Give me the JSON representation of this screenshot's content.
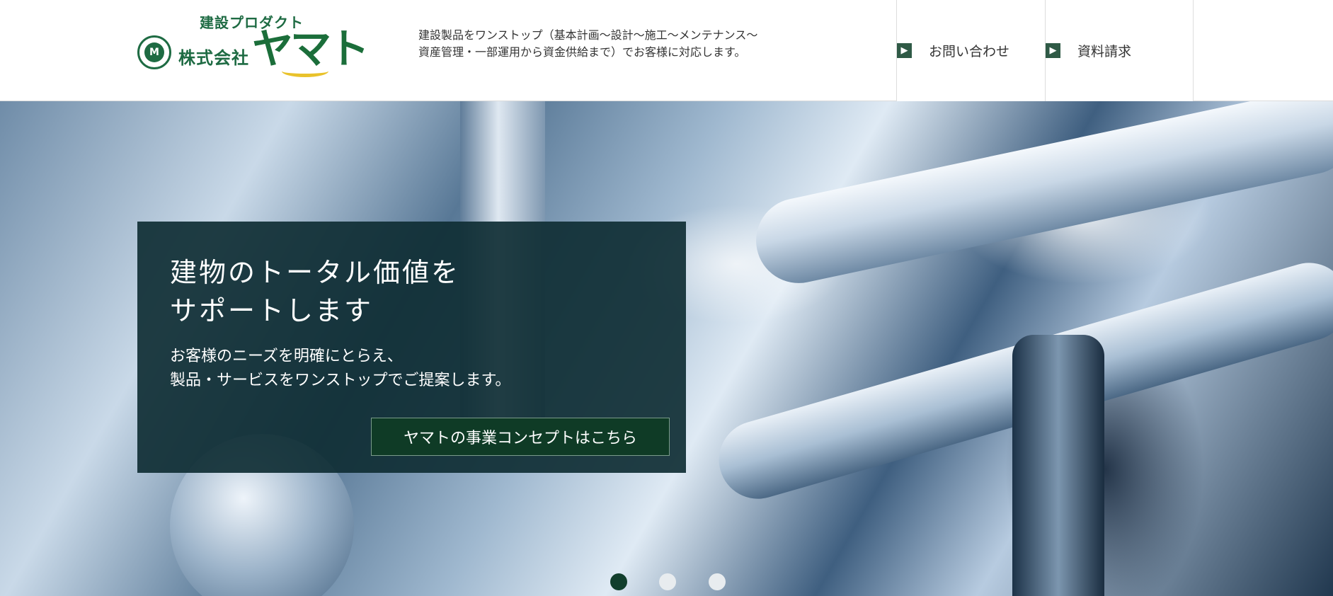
{
  "header": {
    "logo": {
      "subtitle": "建設プロダクト",
      "company_prefix": "株式会社",
      "company_name": "ヤマト",
      "mark": "M"
    },
    "tagline": {
      "line1": "建設製品をワンストップ（基本計画〜設計〜施工〜メンテナンス〜",
      "line2": "資産管理・一部運用から資金供給まで）でお客様に対応します。"
    },
    "nav": [
      {
        "label": "お問い合わせ",
        "icon": "chevron-right-icon"
      },
      {
        "label": "資料請求",
        "icon": "chevron-right-icon"
      }
    ]
  },
  "hero": {
    "title_line1": "建物のトータル価値を",
    "title_line2": "サポートします",
    "body_line1": "お客様のニーズを明確にとらえ、",
    "body_line2": "製品・サービスをワンストップでご提案します。",
    "cta_label": "ヤマトの事業コンセプトはこちら",
    "slider": {
      "total": 3,
      "active_index": 0
    }
  },
  "colors": {
    "brand_green": "#1e6b43",
    "panel_bg": "#0f2e34",
    "cta_bg": "#0f3b26",
    "nav_arrow": "#2f5a46",
    "dot_active": "#123f2d",
    "dot_inactive": "#e8ecef"
  }
}
